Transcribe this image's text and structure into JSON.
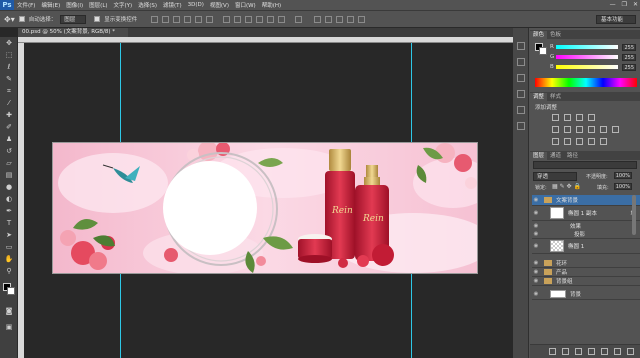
{
  "app": {
    "logo": "Ps"
  },
  "menu": {
    "items": [
      "文件(F)",
      "编辑(E)",
      "图像(I)",
      "图层(L)",
      "文字(Y)",
      "选择(S)",
      "滤镜(T)",
      "3D(D)",
      "视图(V)",
      "窗口(W)",
      "帮助(H)"
    ],
    "window_buttons": [
      "—",
      "❐",
      "✕"
    ]
  },
  "options_bar": {
    "auto_select_label": "自动选择：",
    "auto_select_value": "图层",
    "show_transform_label": "显示变换控件",
    "workspace": "基本功能"
  },
  "document": {
    "tab_title": "00.psd @ 50% (文案背景, RGB/8) *"
  },
  "toolbox": {
    "icons": [
      "move-icon",
      "marquee-icon",
      "lasso-icon",
      "quick-select-icon",
      "crop-icon",
      "eyedropper-icon",
      "healing-icon",
      "brush-icon",
      "stamp-icon",
      "history-brush-icon",
      "eraser-icon",
      "gradient-icon",
      "blur-icon",
      "dodge-icon",
      "pen-icon",
      "type-icon",
      "path-select-icon",
      "shape-icon",
      "hand-icon",
      "zoom-icon"
    ]
  },
  "color_panel": {
    "tabs": [
      "颜色",
      "色板"
    ],
    "channels": [
      {
        "label": "R",
        "value": "255"
      },
      {
        "label": "G",
        "value": "255"
      },
      {
        "label": "B",
        "value": "255"
      }
    ]
  },
  "adjust_panel": {
    "tabs": [
      "调整",
      "样式"
    ],
    "title": "添加调整"
  },
  "layers_panel": {
    "tabs": [
      "图层",
      "通道",
      "路径"
    ],
    "blend_mode": "穿透",
    "opacity_label": "不透明度:",
    "opacity_value": "100%",
    "lock_label": "锁定:",
    "fill_label": "填充:",
    "fill_value": "100%",
    "layers": [
      {
        "name": "文案背景",
        "type": "group",
        "selected": true
      },
      {
        "name": "椭圆 1 副本",
        "type": "shape",
        "selected": false
      },
      {
        "name": "效果",
        "type": "effect",
        "selected": false
      },
      {
        "name": "投影",
        "type": "effect",
        "selected": false
      },
      {
        "name": "椭圆 1",
        "type": "shape",
        "selected": false
      },
      {
        "name": "花环",
        "type": "group",
        "selected": false
      },
      {
        "name": "产品",
        "type": "group",
        "selected": false
      },
      {
        "name": "背景组",
        "type": "group",
        "selected": false
      },
      {
        "name": "背景",
        "type": "layer",
        "selected": false
      }
    ]
  },
  "artwork": {
    "bottle_label": "Rein",
    "colors": {
      "bg": "#f7c9da",
      "accent": "#c81f3a",
      "gold": "#d8b765",
      "cloud": "#fbe2ec"
    }
  }
}
